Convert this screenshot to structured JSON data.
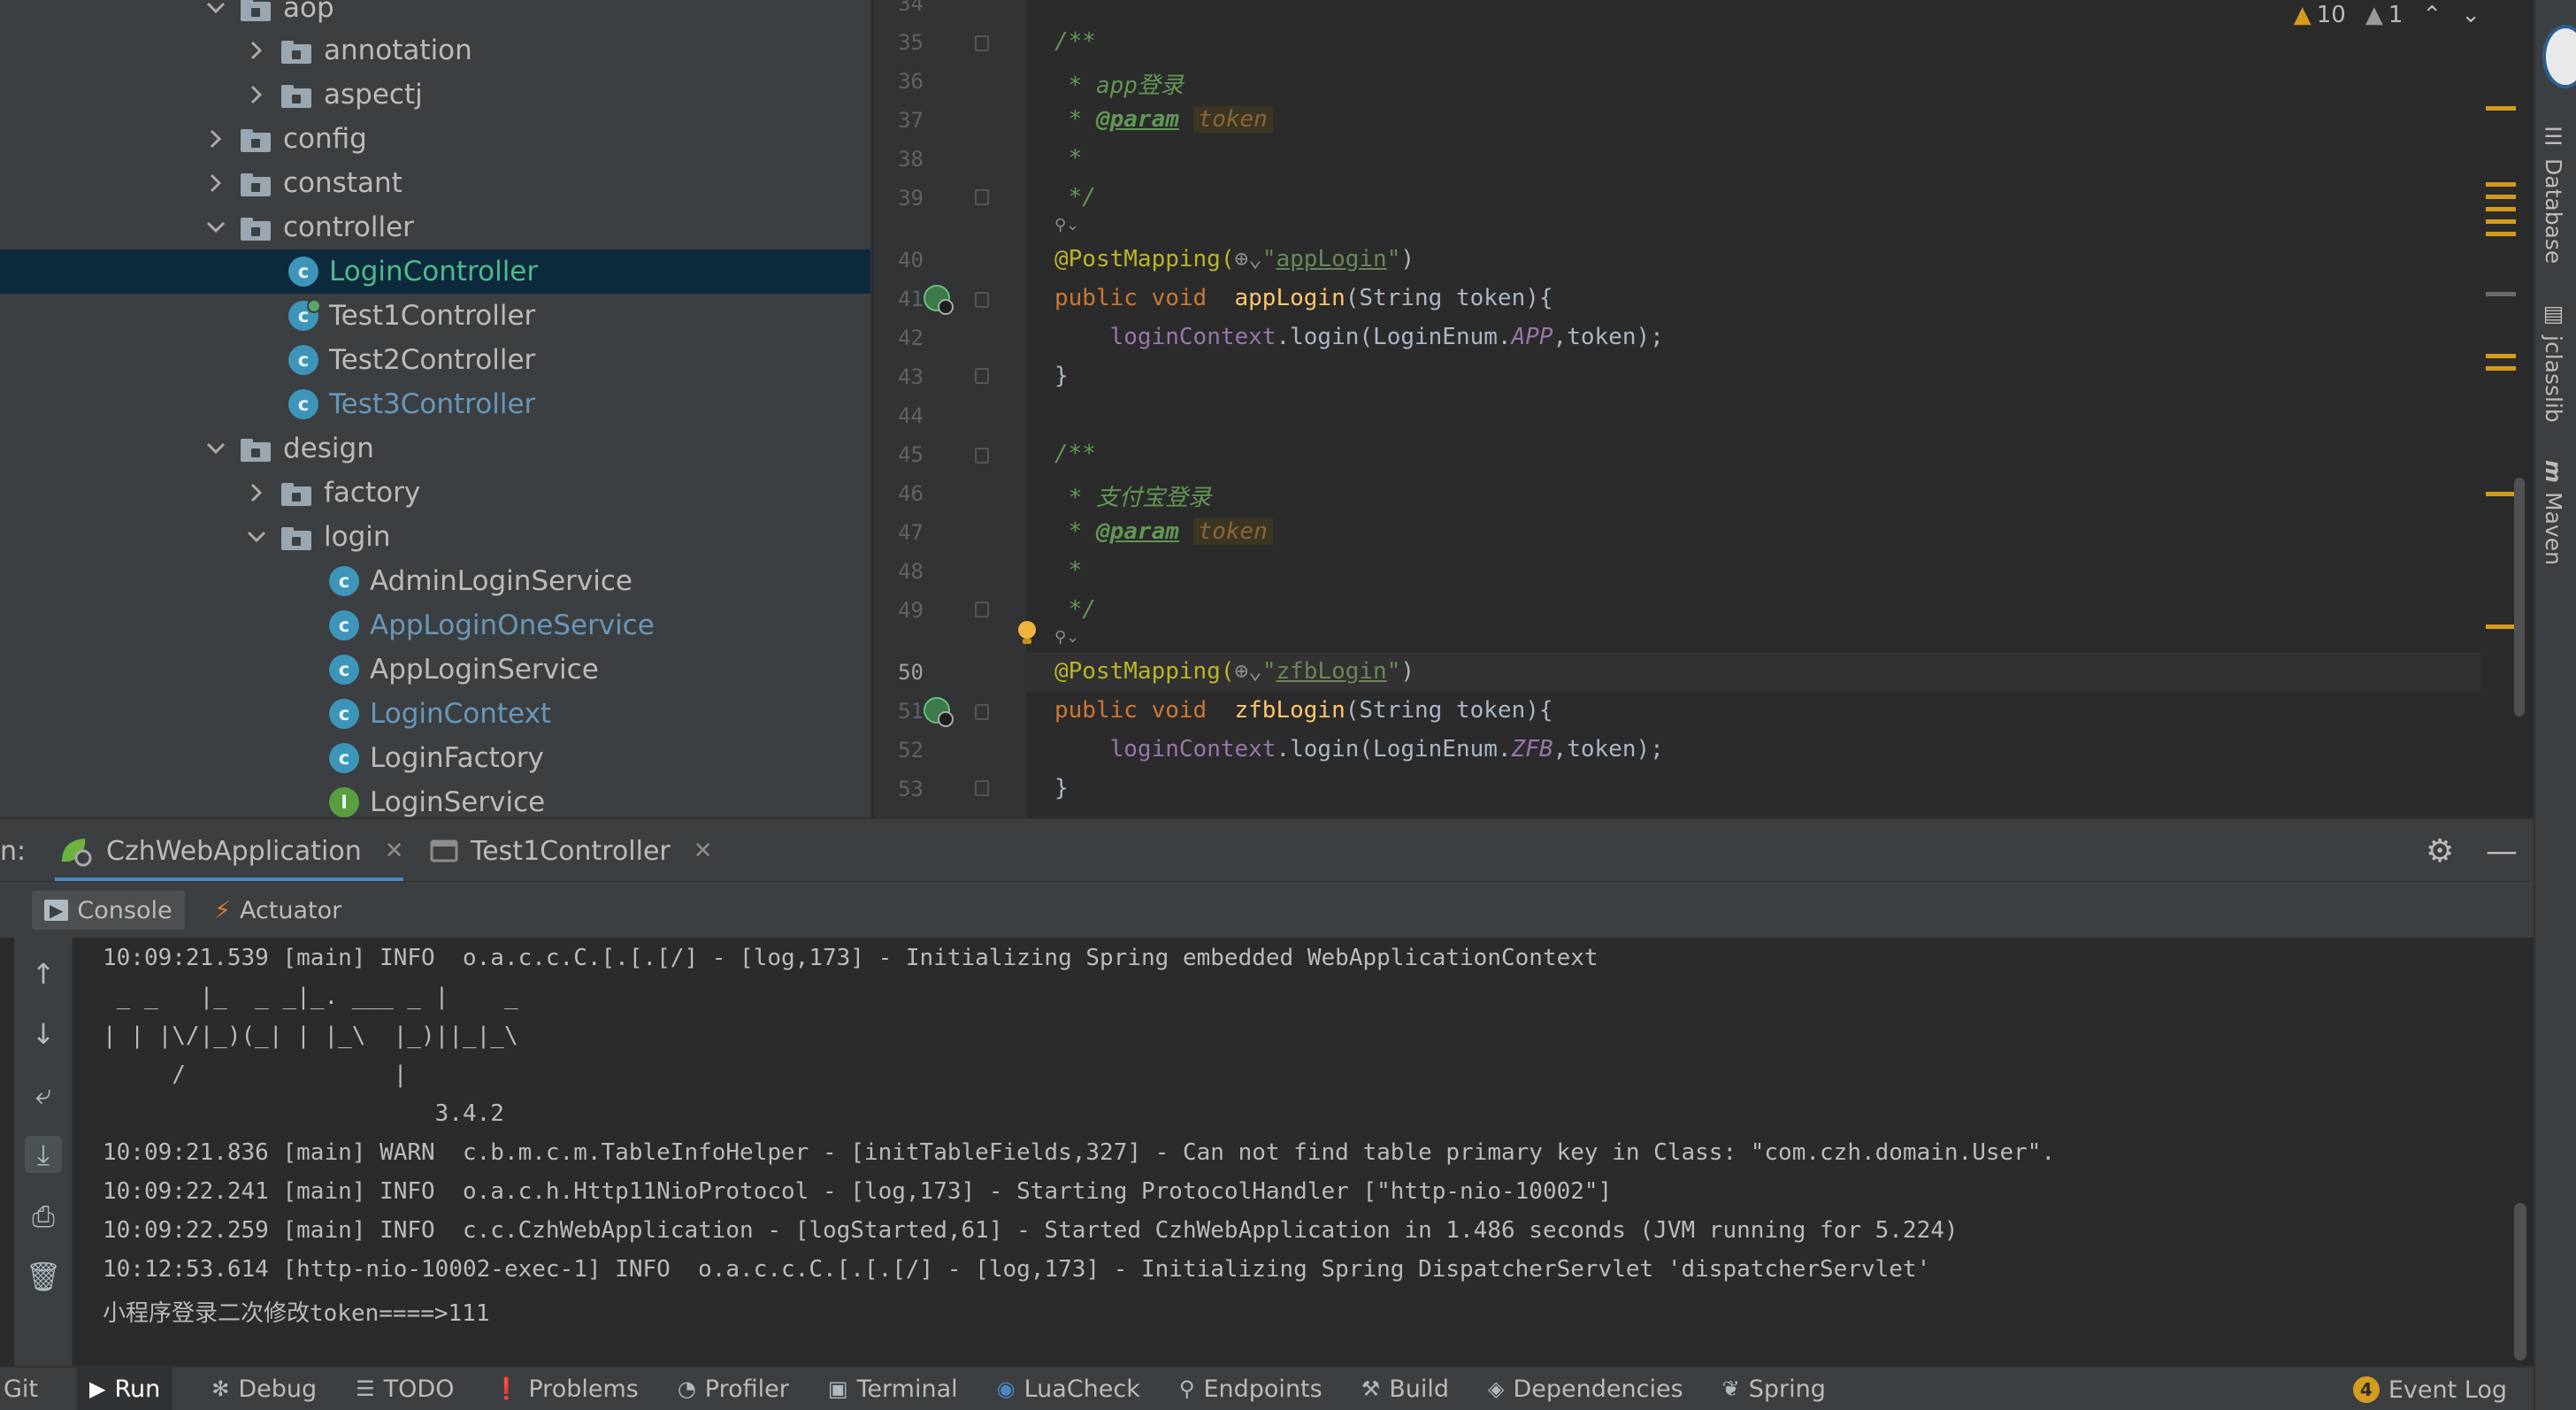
{
  "colors": {
    "tree_bg": "#3c3f41",
    "selected_row": "#0d293e",
    "editor_bg": "#2b2b2b",
    "accent": "#4a88c7",
    "warning": "#d49b1d",
    "comment": "#629755",
    "keyword": "#cc7832",
    "annotation": "#bbb529"
  },
  "tree": [
    {
      "label": "aop",
      "type": "folder",
      "expanded": true
    },
    {
      "label": "annotation",
      "type": "folder",
      "expanded": false
    },
    {
      "label": "aspectj",
      "type": "folder",
      "expanded": false
    },
    {
      "label": "config",
      "type": "folder",
      "expanded": false
    },
    {
      "label": "constant",
      "type": "folder",
      "expanded": false
    },
    {
      "label": "controller",
      "type": "folder",
      "expanded": true
    },
    {
      "label": "LoginController",
      "type": "class",
      "selected": true
    },
    {
      "label": "Test1Controller",
      "type": "class",
      "runnable": true
    },
    {
      "label": "Test2Controller",
      "type": "class"
    },
    {
      "label": "Test3Controller",
      "type": "class"
    },
    {
      "label": "design",
      "type": "folder",
      "expanded": true
    },
    {
      "label": "factory",
      "type": "folder",
      "expanded": false
    },
    {
      "label": "login",
      "type": "folder",
      "expanded": true
    },
    {
      "label": "AdminLoginService",
      "type": "class"
    },
    {
      "label": "AppLoginOneService",
      "type": "class"
    },
    {
      "label": "AppLoginService",
      "type": "class"
    },
    {
      "label": "LoginContext",
      "type": "class"
    },
    {
      "label": "LoginFactory",
      "type": "class"
    },
    {
      "label": "LoginService",
      "type": "interface"
    }
  ],
  "editor": {
    "inspections": {
      "warnings": "10",
      "weak_warnings": "1"
    },
    "line_numbers": [
      "34",
      "35",
      "36",
      "37",
      "38",
      "39",
      "40",
      "41",
      "42",
      "43",
      "44",
      "45",
      "46",
      "47",
      "48",
      "49",
      "50",
      "51",
      "52",
      "53"
    ],
    "current_line": "50",
    "code": {
      "l35": "/**",
      "l36_prefix": " * ",
      "l36_text": "app登录",
      "l37_prefix": " * ",
      "l37_tag": "@param",
      "l37_param": "token",
      "l38": " *",
      "l39": " */",
      "l40_anno": "@PostMapping(",
      "l40_str": "appLogin",
      "l41_kw": "public void",
      "l41_fn": "appLogin",
      "l41_rest": "(String token){",
      "l42_field": "loginContext",
      "l42_mid": ".login(LoginEnum.",
      "l42_enum": "APP",
      "l42_end": ",token);",
      "l43": "}",
      "l45": "/**",
      "l46_prefix": " * ",
      "l46_text": "支付宝登录",
      "l47_prefix": " * ",
      "l47_tag": "@param",
      "l47_param": "token",
      "l48": " *",
      "l49": " */",
      "l50_anno": "@PostMapping(",
      "l50_str": "zfbLogin",
      "l51_kw": "public void",
      "l51_fn": "zfbLogin",
      "l51_rest": "(String token){",
      "l52_field": "loginContext",
      "l52_mid": ".login(LoginEnum.",
      "l52_enum": "ZFB",
      "l52_end": ",token);",
      "l53": "}"
    }
  },
  "right_strip": {
    "database": "Database",
    "jclasslib": "jclasslib",
    "maven": "Maven"
  },
  "run": {
    "prefix": "n:",
    "tabs": [
      "CzhWebApplication",
      "Test1Controller"
    ],
    "subtabs": [
      "Console",
      "Actuator"
    ],
    "console_lines": [
      "10:09:21.539 [main] INFO  o.a.c.c.C.[.[.[/] - [log,173] - Initializing Spring embedded WebApplicationContext",
      " _ _   |_  _ _|_. ___ _ |    _ ",
      "| | |\\/|_)(_| | |_\\  |_)||_|_\\ ",
      "     /               |         ",
      "                        3.4.2 ",
      "10:09:21.836 [main] WARN  c.b.m.c.m.TableInfoHelper - [initTableFields,327] - Can not find table primary key in Class: \"com.czh.domain.User\".",
      "10:09:22.241 [main] INFO  o.a.c.h.Http11NioProtocol - [log,173] - Starting ProtocolHandler [\"http-nio-10002\"]",
      "10:09:22.259 [main] INFO  c.c.CzhWebApplication - [logStarted,61] - Started CzhWebApplication in 1.486 seconds (JVM running for 5.224)",
      "10:12:53.614 [http-nio-10002-exec-1] INFO  o.a.c.c.C.[.[.[/] - [log,173] - Initializing Spring DispatcherServlet 'dispatcherServlet'",
      "小程序登录二次修改token====>111"
    ]
  },
  "statusbar": {
    "items": [
      "Git",
      "Run",
      "Debug",
      "TODO",
      "Problems",
      "Profiler",
      "Terminal",
      "LuaCheck",
      "Endpoints",
      "Build",
      "Dependencies",
      "Spring"
    ],
    "event_log": "Event Log",
    "event_count": "4"
  }
}
